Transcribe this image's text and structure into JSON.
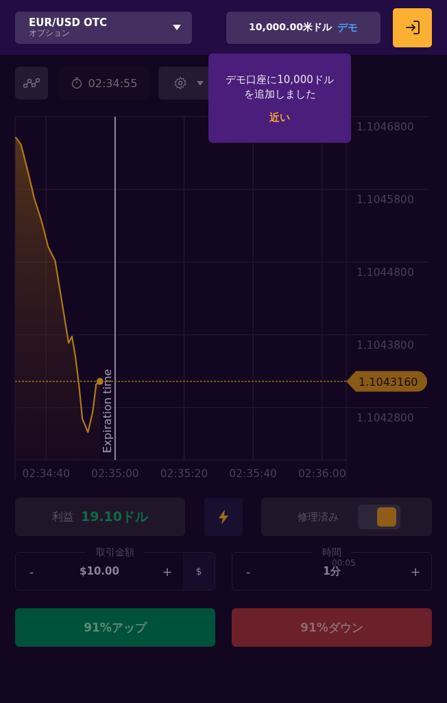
{
  "header": {
    "pair": {
      "name": "EUR/USD OTC",
      "type": "オプション"
    },
    "balance": {
      "amount": "10,000.00米ドル",
      "mode": "デモ"
    }
  },
  "toolbar": {
    "timer": "02:34:55"
  },
  "notification": {
    "message": "デモ口座に10,000ドルを追加しました",
    "action": "近い"
  },
  "chart": {
    "chart_data": {
      "type": "area",
      "grid": true,
      "series": [
        {
          "color": "#b07a1c",
          "values": [
            1.104652,
            1.104642,
            1.104605,
            1.104567,
            1.104538,
            1.104501,
            1.104482,
            1.104425,
            1.104369,
            1.104378,
            1.10435,
            1.104312,
            1.104265,
            1.104246,
            1.104274,
            1.104312,
            1.104316
          ]
        }
      ],
      "x": [
        9271.1,
        9272.7,
        9274.7,
        9276.6,
        9278.6,
        9280.6,
        9282.6,
        9284.6,
        9286.5,
        9287.5,
        9288.5,
        9289.5,
        9290.5,
        9292.1,
        9293.5,
        9294.5,
        9295.6
      ],
      "xlim": [
        9271,
        9367
      ],
      "ylim": [
        1.104208,
        1.10468
      ],
      "xticks": [
        {
          "value": 9280,
          "label": "02:34:40"
        },
        {
          "value": 9300,
          "label": "02:35:00"
        },
        {
          "value": 9320,
          "label": "02:35:20"
        },
        {
          "value": 9340,
          "label": "02:35:40"
        },
        {
          "value": 9360,
          "label": "02:36:00"
        }
      ],
      "yticks": [
        {
          "value": 1.10468,
          "label": "1.1046800"
        },
        {
          "value": 1.10458,
          "label": "1.1045800"
        },
        {
          "value": 1.10448,
          "label": "1.1044800"
        },
        {
          "value": 1.10438,
          "label": "1.1043800"
        },
        {
          "value": 1.10428,
          "label": "1.1042800"
        }
      ],
      "ref_lines": [
        {
          "axis": "x",
          "value": 9300
        },
        {
          "axis": "y",
          "value": 1.104316
        }
      ],
      "annotations": [
        "Expiration time",
        "1.1043160"
      ]
    }
  },
  "trade": {
    "profit": {
      "label": "利益",
      "value": "19.10ドル"
    },
    "fixed": {
      "label": "修理済み",
      "on": true
    },
    "amount": {
      "legend": "取引金額",
      "value": "$10.00",
      "minus": "-",
      "plus": "+",
      "currency": "$"
    },
    "time": {
      "legend": "時間",
      "countdown": "00:05",
      "value": "1分",
      "minus": "-",
      "plus": "+"
    },
    "buttons": [
      {
        "kind": "up",
        "label": "91%アップ"
      },
      {
        "kind": "down",
        "label": "91%ダウン"
      }
    ]
  }
}
